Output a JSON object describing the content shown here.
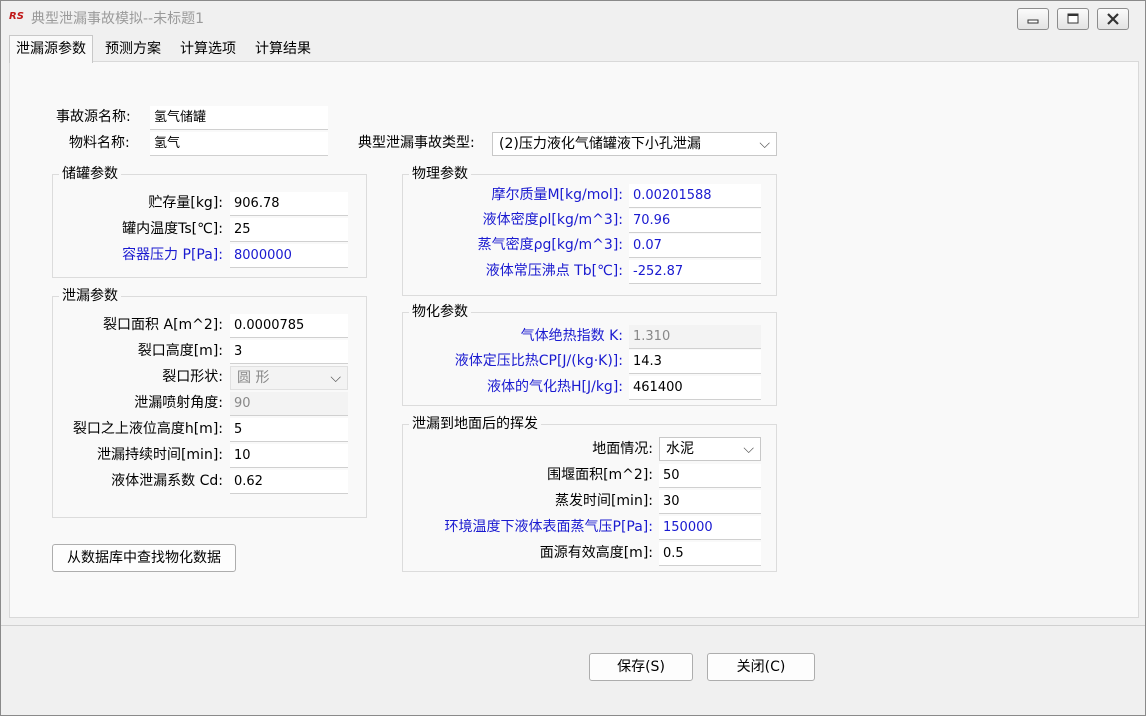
{
  "window": {
    "title": "典型泄漏事故模拟--未标题1",
    "app_icon": "RS"
  },
  "tabs": [
    "泄漏源参数",
    "预测方案",
    "计算选项",
    "计算结果"
  ],
  "source": {
    "name_label": "事故源名称:",
    "name_value": "氢气储罐",
    "material_label": "物料名称:",
    "material_value": "氢气",
    "type_label": "典型泄漏事故类型:",
    "type_value": "(2)压力液化气储罐液下小孔泄漏"
  },
  "tank": {
    "title": "储罐参数",
    "rows": [
      {
        "label": "贮存量[kg]:",
        "value": "906.78",
        "blue": false
      },
      {
        "label": "罐内温度Ts[℃]:",
        "value": "25",
        "blue": false
      },
      {
        "label": "容器压力 P[Pa]:",
        "value": "8000000",
        "blue": true
      }
    ]
  },
  "leak": {
    "title": "泄漏参数",
    "area_label": "裂口面积 A[m^2]:",
    "area_value": "0.0000785",
    "height_label": "裂口高度[m]:",
    "height_value": "3",
    "shape_label": "裂口形状:",
    "shape_value": "圆  形",
    "angle_label": "泄漏喷射角度:",
    "angle_value": "90",
    "level_label": "裂口之上液位高度h[m]:",
    "level_value": "5",
    "duration_label": "泄漏持续时间[min]:",
    "duration_value": "10",
    "coef_label": "液体泄漏系数  Cd:",
    "coef_value": "0.62"
  },
  "physical": {
    "title": "物理参数",
    "rows": [
      {
        "label": "摩尔质量M[kg/mol]:",
        "value": "0.00201588"
      },
      {
        "label": "液体密度ρl[kg/m^3]:",
        "value": "70.96"
      },
      {
        "label": "蒸气密度ρg[kg/m^3]:",
        "value": "0.07"
      },
      {
        "label": "液体常压沸点 Tb[℃]:",
        "value": "-252.87"
      }
    ]
  },
  "chemical": {
    "title": "物化参数",
    "rows": [
      {
        "label": "气体绝热指数 K:",
        "value": "1.310",
        "disabled": true
      },
      {
        "label": "液体定压比热CP[J/(kg·K)]:",
        "value": "14.3",
        "disabled": false
      },
      {
        "label": "液体的气化热H[J/kg]:",
        "value": "461400",
        "disabled": false
      }
    ]
  },
  "evap": {
    "title": "泄漏到地面后的挥发",
    "ground_label": "地面情况:",
    "ground_value": "水泥",
    "dike_label": "围堰面积[m^2]:",
    "dike_value": "50",
    "time_label": "蒸发时间[min]:",
    "time_value": "30",
    "vp_label": "环境温度下液体表面蒸气压P[Pa]:",
    "vp_value": "150000",
    "height_label": "面源有效高度[m]:",
    "height_value": "0.5"
  },
  "buttons": {
    "lookup": "从数据库中查找物化数据",
    "save": "保存(S)",
    "close": "关闭(C)"
  }
}
